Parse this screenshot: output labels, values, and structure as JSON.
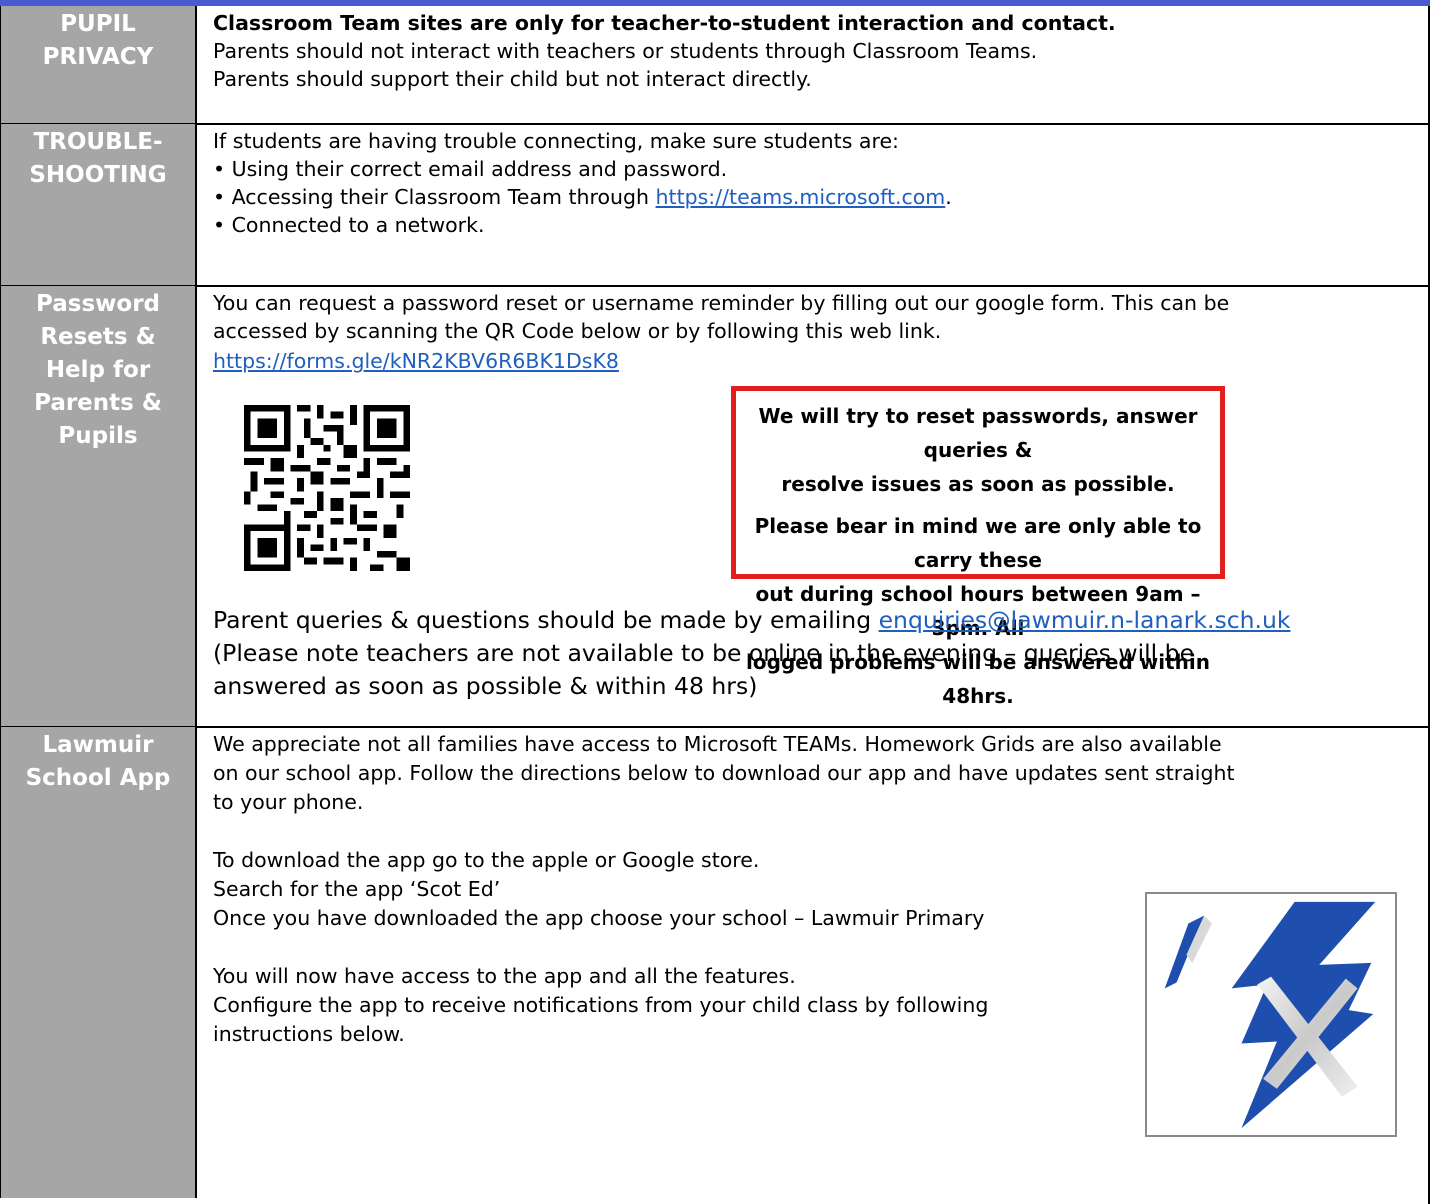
{
  "rows": {
    "privacy": {
      "label_line1": "PUPIL",
      "label_line2": "PRIVACY",
      "line1": "Classroom Team sites are only for teacher-to-student interaction and contact.",
      "line2": "Parents should not interact with teachers or students through Classroom Teams.",
      "line3": "Parents should support their child but not interact directly."
    },
    "trouble": {
      "label_line1": "TROUBLE-",
      "label_line2": "SHOOTING",
      "intro": "If students are having trouble connecting, make sure students are:",
      "bullet1": "• Using their correct email address and password.",
      "bullet2_prefix": "• Accessing their Classroom Team through ",
      "bullet2_link": "https://teams.microsoft.com",
      "bullet2_suffix": ".",
      "bullet3": "• Connected to a network."
    },
    "password": {
      "label_line1": "Password",
      "label_line2": "Resets &",
      "label_line3": "Help for",
      "label_line4": "Parents &",
      "label_line5": "Pupils",
      "line1": "You can request a password reset or username reminder by filling out our google form. This can be",
      "line2": "accessed by scanning the QR Code below or by following this web link.",
      "form_link": "https://forms.gle/kNR2KBV6R6BK1DsK8",
      "notice1_line1": "We will try to reset passwords, answer queries &",
      "notice1_line2": "resolve issues as soon as possible.",
      "notice2_line1": "Please bear in mind we are only able to carry these",
      "notice2_line2": "out during school hours between 9am – 3pm.  All",
      "notice2_line3": "logged problems will be answered within 48hrs.",
      "queries_prefix": "Parent queries & questions should be made by emailing ",
      "queries_email": "enquiries@lawmuir.n-lanark.sch.uk",
      "note_line1": "(Please note teachers are not available to be online in the evening – queries will be",
      "note_line2": "answered as soon as possible & within 48 hrs)"
    },
    "app": {
      "label_line1": "Lawmuir",
      "label_line2": "School App",
      "p1_line1": "We appreciate not all families have access to Microsoft TEAMs. Homework Grids are also available",
      "p1_line2": "on our school app. Follow the directions below to download our app and have updates sent straight",
      "p1_line3": "to your phone.",
      "p2_line1": "To download the app go to the apple or Google store.",
      "p2_line2": "Search for the app ‘Scot Ed’",
      "p2_line3": "Once you have downloaded the app choose your school – Lawmuir Primary",
      "p3_line1": "You will now have access to the app and all the features.",
      "p3_line2": "Configure the app to receive notifications from your child class by following",
      "p3_line3": "instructions below."
    }
  },
  "colors": {
    "label_bg": "#a6a6a6",
    "link": "#1f5fbf",
    "notice_border": "#e31e1e",
    "flag_blue": "#1e4fae"
  },
  "icons": {
    "qr": "qr-code-icon",
    "app_logo": "scot-ed-logo-icon"
  }
}
